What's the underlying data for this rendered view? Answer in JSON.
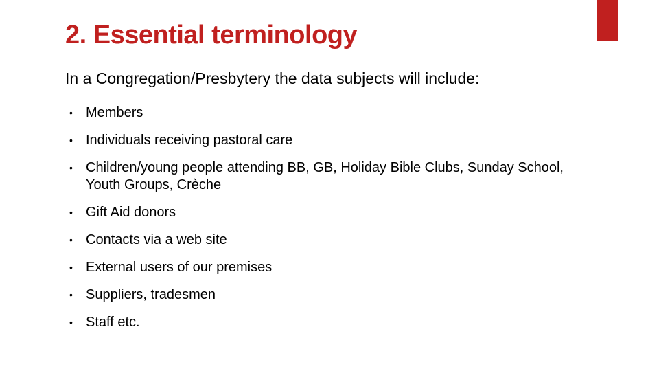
{
  "title": "2. Essential terminology",
  "subtitle": "In a Congregation/Presbytery the data subjects will include:",
  "bullets": [
    "Members",
    "Individuals receiving pastoral care",
    "Children/young people attending  BB, GB, Holiday Bible Clubs, Sunday School, Youth Groups, Crèche",
    "Gift Aid donors",
    "Contacts via a web site",
    "External users of our premises",
    "Suppliers, tradesmen",
    "Staff etc."
  ]
}
